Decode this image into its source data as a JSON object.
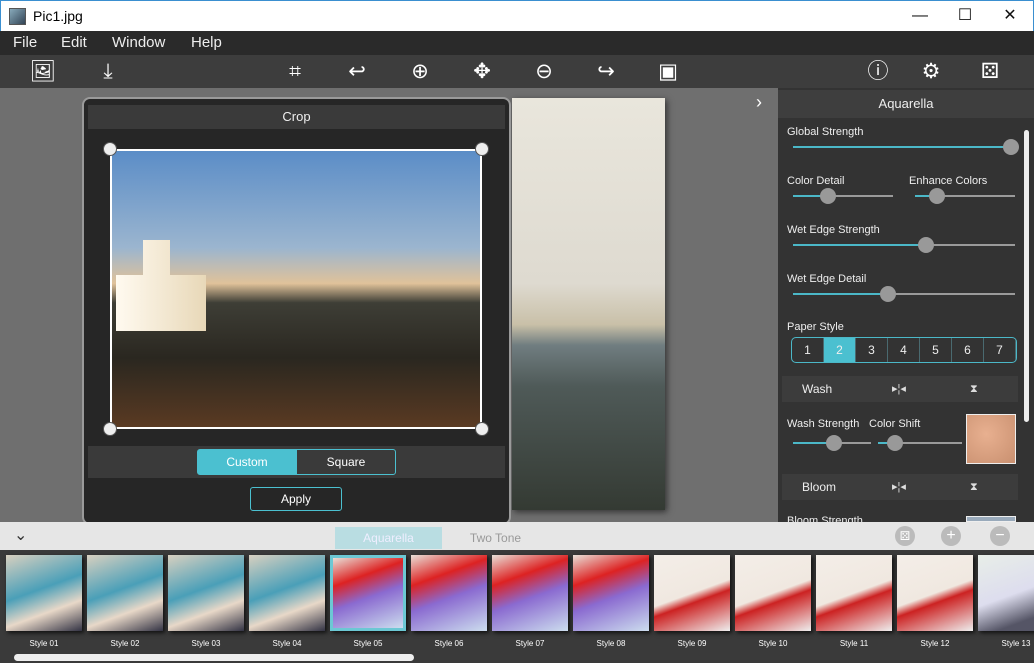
{
  "window": {
    "title": "Pic1.jpg",
    "minimize": "—",
    "maximize": "☐",
    "close": "✕"
  },
  "menu": [
    "File",
    "Edit",
    "Window",
    "Help"
  ],
  "toolbar": {
    "left": [
      {
        "icon": "open-image-icon",
        "glyph": "🖼"
      },
      {
        "icon": "save-icon",
        "glyph": "⤓"
      }
    ],
    "center": [
      {
        "icon": "crop-icon",
        "glyph": "⌗"
      },
      {
        "icon": "undo-icon",
        "glyph": "↩"
      },
      {
        "icon": "zoom-in-icon",
        "glyph": "⊕"
      },
      {
        "icon": "move-icon",
        "glyph": "✥"
      },
      {
        "icon": "zoom-out-icon",
        "glyph": "⊖"
      },
      {
        "icon": "redo-icon",
        "glyph": "↪"
      },
      {
        "icon": "fit-image-icon",
        "glyph": "▣"
      }
    ],
    "right": [
      {
        "icon": "info-icon",
        "glyph": "ⓘ"
      },
      {
        "icon": "settings-icon",
        "glyph": "⚙"
      },
      {
        "icon": "random-dice-icon",
        "glyph": "⚄"
      }
    ]
  },
  "crop": {
    "title": "Crop",
    "modes": [
      "Custom",
      "Square"
    ],
    "active_mode": "Custom",
    "apply": "Apply"
  },
  "panel": {
    "title": "Aquarella",
    "expand_glyph": "›",
    "sliders": {
      "global_strength": {
        "label": "Global Strength",
        "value": 0.98
      },
      "color_detail": {
        "label": "Color Detail",
        "value": 0.35
      },
      "enhance_colors": {
        "label": "Enhance Colors",
        "value": 0.22
      },
      "wet_edge_strength": {
        "label": "Wet Edge Strength",
        "value": 0.6
      },
      "wet_edge_detail": {
        "label": "Wet Edge Detail",
        "value": 0.43
      },
      "wash_strength": {
        "label": "Wash Strength",
        "value": 0.53
      },
      "color_shift": {
        "label": "Color Shift",
        "value": 0.2
      },
      "bloom_strength": {
        "label": "Bloom Strength"
      }
    },
    "paper_style": {
      "label": "Paper Style",
      "options": [
        "1",
        "2",
        "3",
        "4",
        "5",
        "6",
        "7"
      ],
      "selected": "2"
    },
    "sections": [
      "Wash",
      "Bloom"
    ]
  },
  "bottom": {
    "collapse_glyph": "⌄",
    "tabs": [
      "Aquarella",
      "Two Tone"
    ],
    "active_tab": "Aquarella"
  },
  "styles": [
    "Style 01",
    "Style 02",
    "Style 03",
    "Style 04",
    "Style 05",
    "Style 06",
    "Style 07",
    "Style 08",
    "Style 09",
    "Style 10",
    "Style 11",
    "Style 12",
    "Style 13"
  ],
  "selected_style": "Style 05",
  "colors": {
    "accent": "#4bc0d0",
    "panel": "#333333",
    "menubar": "#2a2a2a"
  }
}
